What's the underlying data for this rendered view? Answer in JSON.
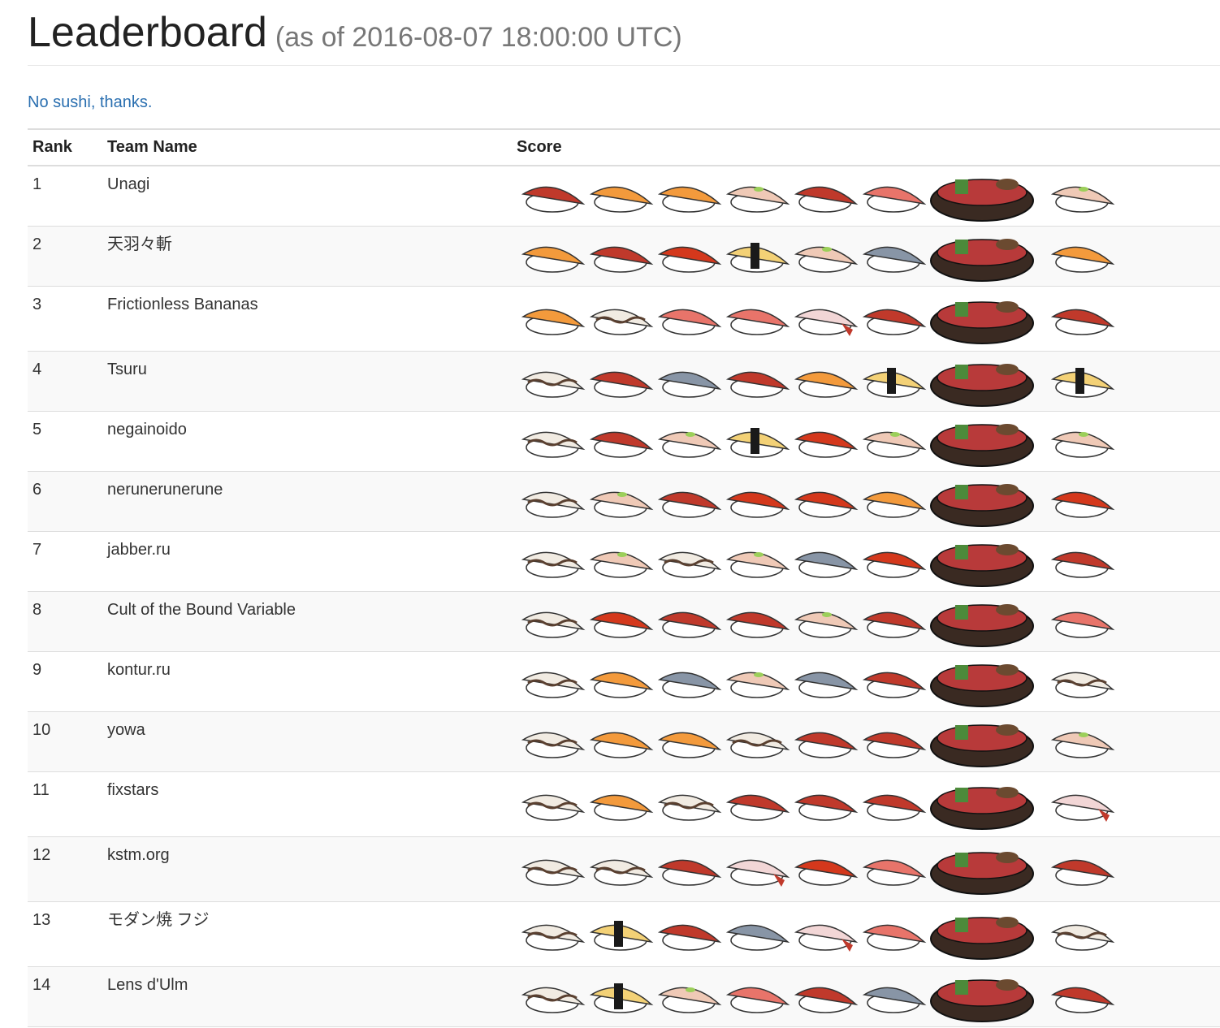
{
  "page": {
    "title": "Leaderboard",
    "subtitle": "(as of 2016-08-07 18:00:00 UTC)",
    "link_text": "No sushi, thanks."
  },
  "table": {
    "headers": {
      "rank": "Rank",
      "team": "Team Name",
      "score": "Score"
    },
    "rows": [
      {
        "rank": "1",
        "team": "Unagi",
        "score": [
          "tuna",
          "salmon",
          "salmon",
          "hamachi",
          "tuna",
          "toro",
          "bowl",
          "hamachi"
        ]
      },
      {
        "rank": "2",
        "team": "天羽々斬",
        "score": [
          "salmon",
          "tuna",
          "akagai",
          "tamago",
          "hamachi",
          "saba",
          "bowl",
          "salmon"
        ]
      },
      {
        "rank": "3",
        "team": "Frictionless Bananas",
        "score": [
          "salmon",
          "anago",
          "toro",
          "toro",
          "ebi",
          "tuna",
          "bowl",
          "tuna"
        ]
      },
      {
        "rank": "4",
        "team": "Tsuru",
        "score": [
          "anago",
          "tuna",
          "saba",
          "tuna",
          "salmon",
          "tamago",
          "bowl",
          "tamago"
        ]
      },
      {
        "rank": "5",
        "team": "negainoido",
        "score": [
          "anago",
          "tuna",
          "hamachi",
          "tamago",
          "akagai",
          "hamachi",
          "bowl",
          "hamachi"
        ]
      },
      {
        "rank": "6",
        "team": "nerunerunerune",
        "score": [
          "anago",
          "hamachi",
          "tuna",
          "akagai",
          "akagai",
          "salmon",
          "bowl",
          "akagai"
        ]
      },
      {
        "rank": "7",
        "team": "jabber.ru",
        "score": [
          "anago",
          "hamachi",
          "anago",
          "hamachi",
          "saba",
          "akagai",
          "bowl",
          "tuna"
        ]
      },
      {
        "rank": "8",
        "team": "Cult of the Bound Variable",
        "score": [
          "anago",
          "akagai",
          "tuna",
          "tuna",
          "hamachi",
          "tuna",
          "bowl",
          "toro"
        ]
      },
      {
        "rank": "9",
        "team": "kontur.ru",
        "score": [
          "anago",
          "salmon",
          "saba",
          "hamachi",
          "saba",
          "tuna",
          "bowl",
          "anago"
        ]
      },
      {
        "rank": "10",
        "team": "yowa",
        "score": [
          "anago",
          "salmon",
          "salmon",
          "anago",
          "tuna",
          "tuna",
          "bowl",
          "hamachi"
        ]
      },
      {
        "rank": "11",
        "team": "fixstars",
        "score": [
          "anago",
          "salmon",
          "anago",
          "tuna",
          "tuna",
          "tuna",
          "bowl",
          "ebi"
        ]
      },
      {
        "rank": "12",
        "team": "kstm.org",
        "score": [
          "anago",
          "anago",
          "tuna",
          "ebi",
          "akagai",
          "toro",
          "bowl",
          "tuna"
        ]
      },
      {
        "rank": "13",
        "team": "モダン焼 フジ",
        "score": [
          "anago",
          "tamago",
          "tuna",
          "saba",
          "ebi",
          "toro",
          "bowl",
          "anago"
        ]
      },
      {
        "rank": "14",
        "team": "Lens d'Ulm",
        "score": [
          "anago",
          "tamago",
          "hamachi",
          "toro",
          "tuna",
          "saba",
          "bowl",
          "tuna"
        ]
      }
    ]
  },
  "colors": {
    "link": "#2a6fb0",
    "tuna": "#c0392b",
    "salmon": "#f39a3c",
    "toro": "#e8746a",
    "hamachi": "#efc9b6",
    "akagai": "#d4381c",
    "tamago": "#f3d176",
    "saba": "#8895a6",
    "anago": "#f1ebe2",
    "ebi": "#f2d6d6",
    "bowl": "#3a2a22"
  }
}
